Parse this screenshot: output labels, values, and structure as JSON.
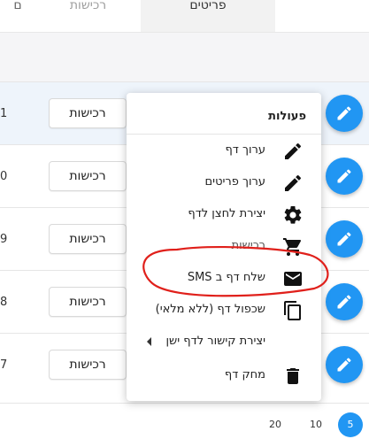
{
  "tabs": {
    "left_partial": "ם",
    "purchases": "רכישות",
    "items": "פריטים"
  },
  "rows": [
    {
      "num": "1",
      "purchases_label": "רכישות"
    },
    {
      "num": "0",
      "purchases_label": "רכישות"
    },
    {
      "num": "9",
      "purchases_label": "רכישות"
    },
    {
      "num": "8",
      "purchases_label": "רכישות"
    },
    {
      "num": "7",
      "purchases_label": "רכישות"
    }
  ],
  "menu": {
    "title": "פעולות",
    "items": [
      {
        "label": "ערוך דף",
        "icon": "pencil-icon"
      },
      {
        "label": "ערוך פריטים",
        "icon": "pencil-icon"
      },
      {
        "label": "יצירת לחצן לדף",
        "icon": "gear-icon"
      },
      {
        "label": "רכישות",
        "icon": "cart-icon"
      },
      {
        "label": "שלח דף ב SMS",
        "icon": "envelope-icon"
      },
      {
        "label": "שכפול דף (ללא מלאי)",
        "icon": "copy-icon"
      },
      {
        "label": "יצירת קישור לדף ישן",
        "icon": "caret-left-icon"
      },
      {
        "label": "מחק דף",
        "icon": "trash-icon"
      }
    ]
  },
  "pagination": {
    "options": [
      "20",
      "10",
      "5"
    ],
    "selected": "5"
  },
  "colors": {
    "accent": "#2196f3",
    "annotation": "#e0201b"
  }
}
